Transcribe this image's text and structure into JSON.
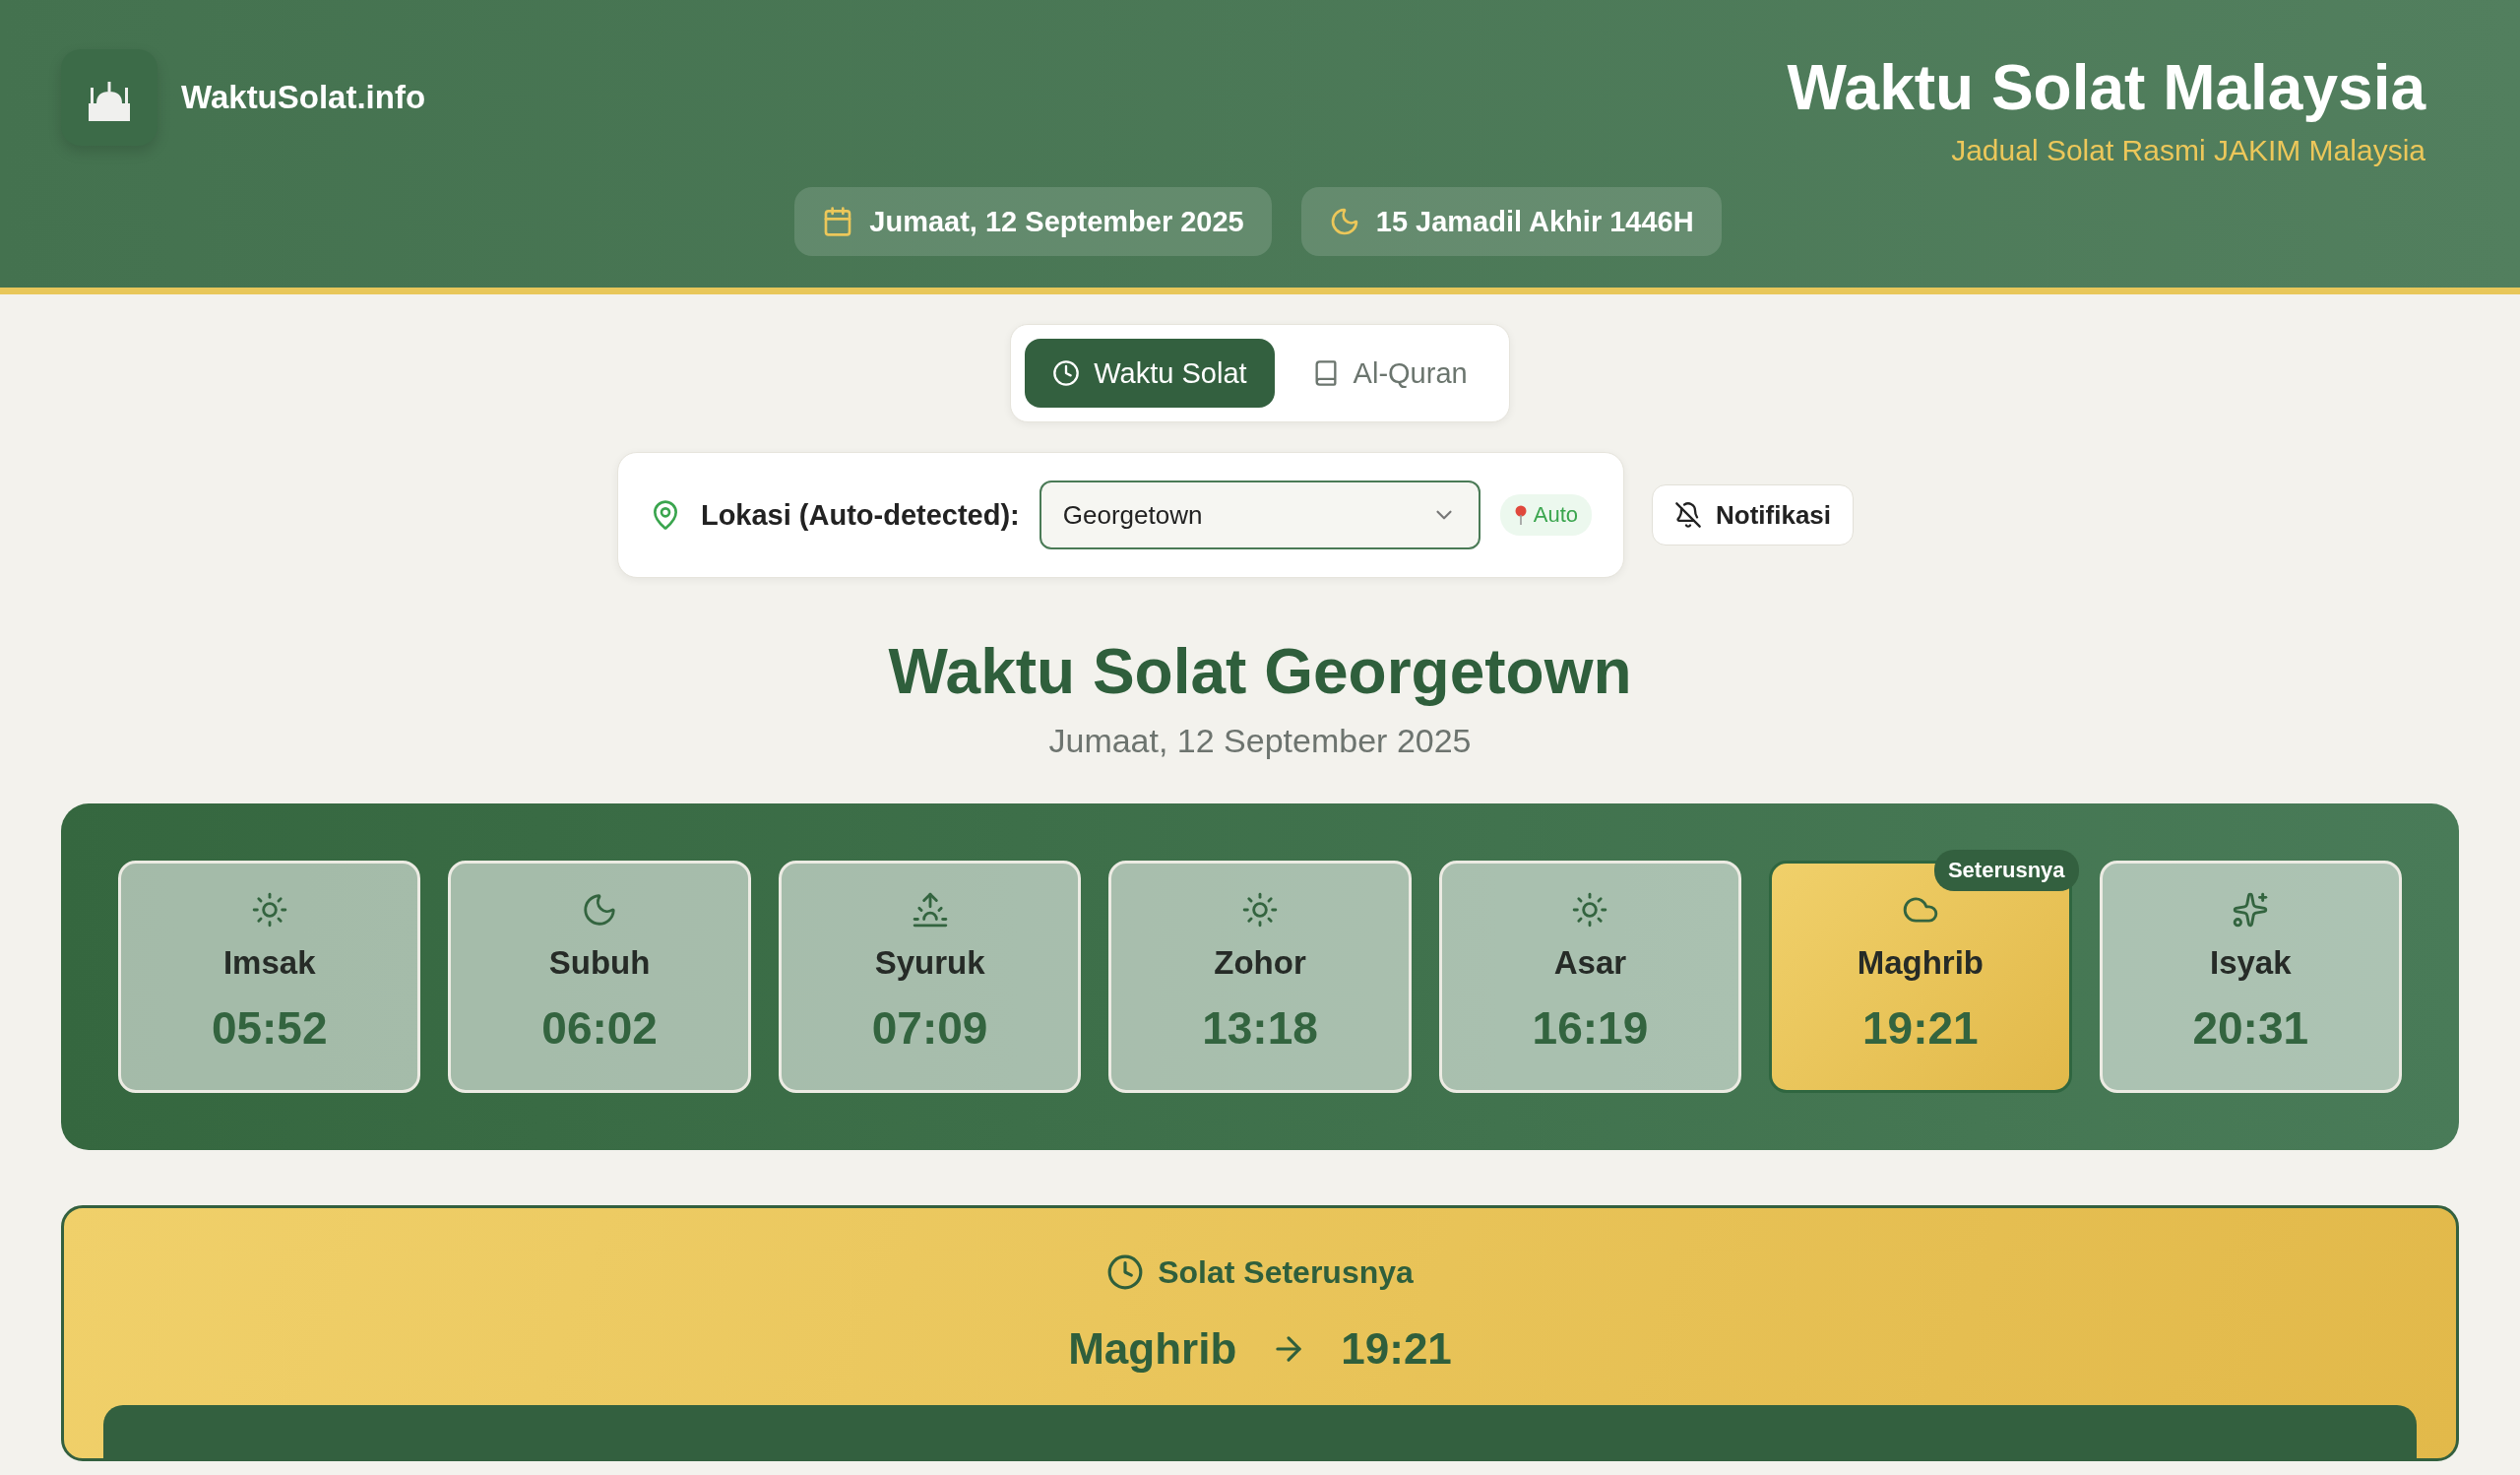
{
  "header": {
    "brand": "WaktuSolat.info",
    "title": "Waktu Solat Malaysia",
    "subtitle": "Jadual Solat Rasmi JAKIM Malaysia",
    "gregorian_date": "Jumaat, 12 September 2025",
    "hijri_date": "15 Jamadil Akhir 1446H"
  },
  "tabs": [
    {
      "label": "Waktu Solat",
      "kind": "clock",
      "selected": true
    },
    {
      "label": "Al-Quran",
      "kind": "book",
      "selected": false
    }
  ],
  "location": {
    "label": "Lokasi (Auto-detected):",
    "value": "Georgetown",
    "badge": "Auto",
    "notify_button": "Notifikasi"
  },
  "heading": {
    "title": "Waktu Solat Georgetown",
    "date": "Jumaat, 12 September 2025"
  },
  "prayers": [
    {
      "name": "Imsak",
      "time": "05:52",
      "kind": "sun",
      "selected": false
    },
    {
      "name": "Subuh",
      "time": "06:02",
      "kind": "moon",
      "selected": false
    },
    {
      "name": "Syuruk",
      "time": "07:09",
      "kind": "sunrise",
      "selected": false
    },
    {
      "name": "Zohor",
      "time": "13:18",
      "kind": "sun",
      "selected": false
    },
    {
      "name": "Asar",
      "time": "16:19",
      "kind": "sun",
      "selected": false
    },
    {
      "name": "Maghrib",
      "time": "19:21",
      "kind": "cloud",
      "selected": true,
      "badge": "Seterusnya"
    },
    {
      "name": "Isyak",
      "time": "20:31",
      "kind": "sparkles",
      "selected": false
    }
  ],
  "next_prayer": {
    "title": "Solat Seterusnya",
    "name": "Maghrib",
    "time": "19:21"
  }
}
